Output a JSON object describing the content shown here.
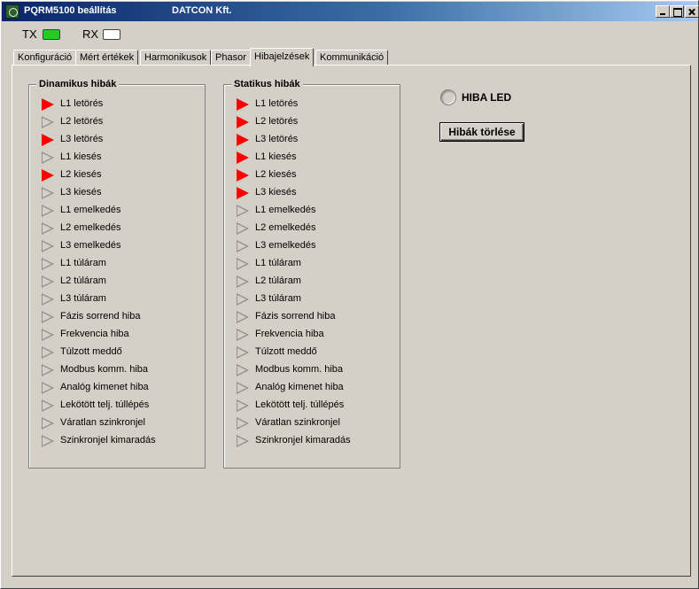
{
  "window": {
    "title": "PQRM5100 beállítás",
    "company": "DATCON Kft."
  },
  "indicators": {
    "tx_label": "TX",
    "rx_label": "RX",
    "tx_color": "#22cc22",
    "rx_color": "#ffffff"
  },
  "tabs": [
    {
      "label": "Konfiguráció"
    },
    {
      "label": "Mért értékek"
    },
    {
      "label": "Harmonikusok"
    },
    {
      "label": "Phasor"
    },
    {
      "label": "Hibajelzések",
      "active": true
    },
    {
      "label": "Kommunikáció"
    }
  ],
  "colors": {
    "fault_active": "#ff0000",
    "fault_inactive": "#909090"
  },
  "dynamic": {
    "title": "Dinamikus hibák",
    "items": [
      {
        "label": "L1 letörés",
        "active": true
      },
      {
        "label": "L2 letörés",
        "active": false
      },
      {
        "label": "L3 letörés",
        "active": true
      },
      {
        "label": "L1 kiesés",
        "active": false
      },
      {
        "label": "L2 kiesés",
        "active": true
      },
      {
        "label": "L3 kiesés",
        "active": false
      },
      {
        "label": "L1 emelkedés",
        "active": false
      },
      {
        "label": "L2 emelkedés",
        "active": false
      },
      {
        "label": "L3 emelkedés",
        "active": false
      },
      {
        "label": "L1 túláram",
        "active": false
      },
      {
        "label": "L2 túláram",
        "active": false
      },
      {
        "label": "L3 túláram",
        "active": false
      },
      {
        "label": "Fázis sorrend hiba",
        "active": false
      },
      {
        "label": "Frekvencia hiba",
        "active": false
      },
      {
        "label": "Túlzott meddő",
        "active": false
      },
      {
        "label": "Modbus komm. hiba",
        "active": false
      },
      {
        "label": "Analóg kimenet hiba",
        "active": false
      },
      {
        "label": "Lekötött telj. túllépés",
        "active": false
      },
      {
        "label": "Váratlan szinkronjel",
        "active": false
      },
      {
        "label": "Szinkronjel kimaradás",
        "active": false
      }
    ]
  },
  "static": {
    "title": "Statikus hibák",
    "items": [
      {
        "label": "L1 letörés",
        "active": true
      },
      {
        "label": "L2 letörés",
        "active": true
      },
      {
        "label": "L3 letörés",
        "active": true
      },
      {
        "label": "L1 kiesés",
        "active": true
      },
      {
        "label": "L2 kiesés",
        "active": true
      },
      {
        "label": "L3 kiesés",
        "active": true
      },
      {
        "label": "L1 emelkedés",
        "active": false
      },
      {
        "label": "L2 emelkedés",
        "active": false
      },
      {
        "label": "L3 emelkedés",
        "active": false
      },
      {
        "label": "L1 túláram",
        "active": false
      },
      {
        "label": "L2 túláram",
        "active": false
      },
      {
        "label": "L3 túláram",
        "active": false
      },
      {
        "label": "Fázis sorrend hiba",
        "active": false
      },
      {
        "label": "Frekvencia hiba",
        "active": false
      },
      {
        "label": "Túlzott meddő",
        "active": false
      },
      {
        "label": "Modbus komm. hiba",
        "active": false
      },
      {
        "label": "Analóg kimenet hiba",
        "active": false
      },
      {
        "label": "Lekötött telj. túllépés",
        "active": false
      },
      {
        "label": "Váratlan szinkronjel",
        "active": false
      },
      {
        "label": "Szinkronjel kimaradás",
        "active": false
      }
    ]
  },
  "hiba_led": {
    "label": "HIBA LED",
    "lit": false
  },
  "clear_button": {
    "label": "Hibák törlése"
  }
}
